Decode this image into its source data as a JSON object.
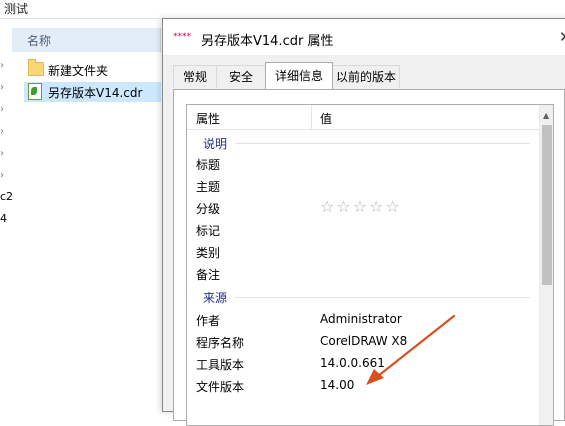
{
  "explorer": {
    "title": "测试",
    "column_header": "名称",
    "items": [
      {
        "label": "新建文件夹",
        "icon": "folder-icon",
        "selected": false
      },
      {
        "label": "另存版本V14.cdr",
        "icon": "cdr-file-icon",
        "selected": true
      }
    ],
    "side_text_1": "c2",
    "side_text_2": "4"
  },
  "dialog": {
    "icon": "****",
    "title": "另存版本V14.cdr 属性",
    "close_glyph": "✕",
    "tabs": [
      {
        "label": "常规",
        "active": false
      },
      {
        "label": "安全",
        "active": false
      },
      {
        "label": "详细信息",
        "active": true
      },
      {
        "label": "以前的版本",
        "active": false
      }
    ],
    "list_header": {
      "property": "属性",
      "value": "值"
    },
    "groups": [
      {
        "title": "说明",
        "rows": [
          {
            "name": "标题",
            "value": ""
          },
          {
            "name": "主题",
            "value": ""
          },
          {
            "name": "分级",
            "value": "☆☆☆☆☆",
            "rating": 0
          },
          {
            "name": "标记",
            "value": ""
          },
          {
            "name": "类别",
            "value": ""
          },
          {
            "name": "备注",
            "value": ""
          }
        ]
      },
      {
        "title": "来源",
        "rows": [
          {
            "name": "作者",
            "value": "Administrator"
          },
          {
            "name": "程序名称",
            "value": "CorelDRAW X8"
          },
          {
            "name": "工具版本",
            "value": "14.0.0.661"
          },
          {
            "name": "文件版本",
            "value": "14.00"
          }
        ]
      }
    ]
  },
  "colors": {
    "accent": "#e0004d",
    "selection": "#cce8ff",
    "group_title": "#1e3287",
    "annotation_arrow": "#d9501f"
  }
}
